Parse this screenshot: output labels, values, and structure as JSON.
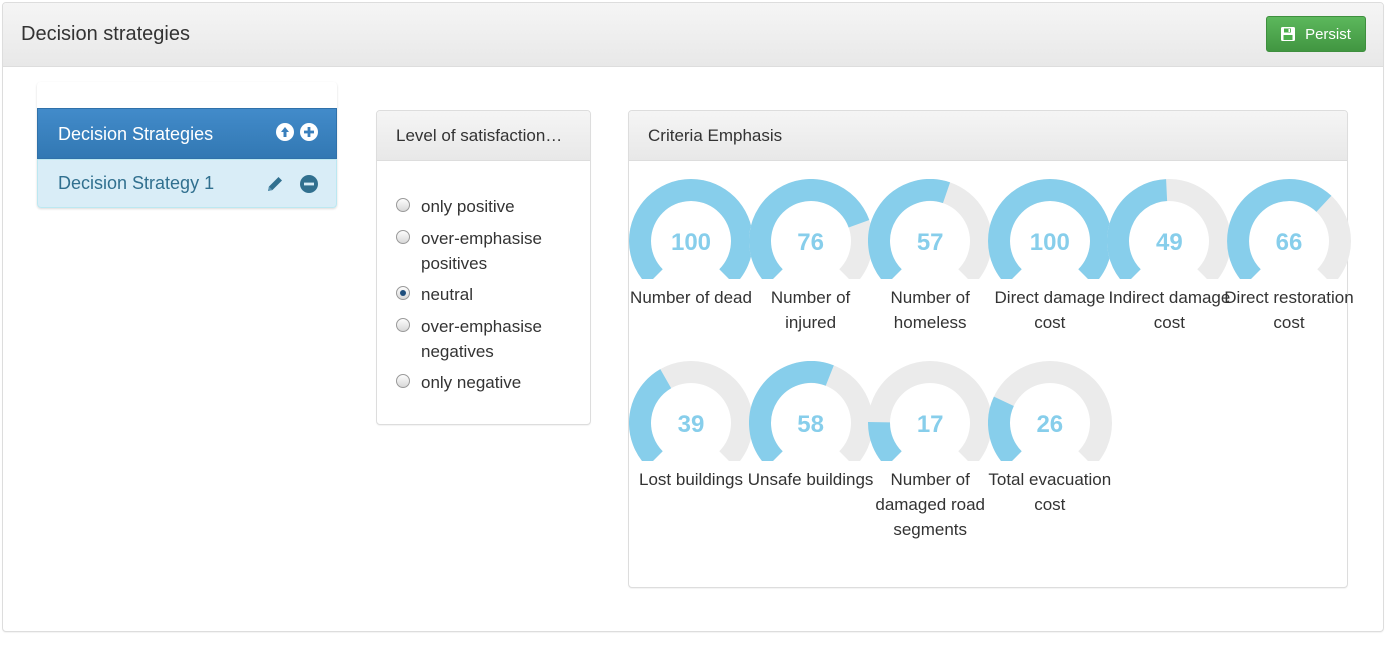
{
  "header": {
    "title": "Decision strategies",
    "persist_label": "Persist"
  },
  "strategies": {
    "header_label": "Decision Strategies",
    "items": [
      {
        "label": "Decision Strategy 1"
      }
    ]
  },
  "satisfaction": {
    "title": "Level of satisfaction…",
    "options": [
      {
        "label": "only positive",
        "checked": false
      },
      {
        "label": "over-emphasise positives",
        "checked": false
      },
      {
        "label": "neutral",
        "checked": true
      },
      {
        "label": "over-emphasise negatives",
        "checked": false
      },
      {
        "label": "only negative",
        "checked": false
      }
    ]
  },
  "criteria": {
    "title": "Criteria Emphasis",
    "gauge_color": "#87ceeb",
    "track_color": "#ebebeb",
    "items": [
      {
        "value": 100,
        "label": "Number of dead"
      },
      {
        "value": 76,
        "label": "Number of injured"
      },
      {
        "value": 57,
        "label": "Number of homeless"
      },
      {
        "value": 100,
        "label": "Direct damage cost"
      },
      {
        "value": 49,
        "label": "Indirect damage cost"
      },
      {
        "value": 66,
        "label": "Direct restoration cost"
      },
      {
        "value": 39,
        "label": "Lost buildings"
      },
      {
        "value": 58,
        "label": "Unsafe buildings"
      },
      {
        "value": 17,
        "label": "Number of damaged road segments"
      },
      {
        "value": 26,
        "label": "Total evacuation cost"
      }
    ]
  },
  "colors": {
    "primary": "#428bca",
    "success": "#5cb85c",
    "info_bg": "#d9edf7",
    "info_text": "#31708f"
  },
  "icons": {
    "persist": "floppy-disk-icon",
    "move_up": "circle-arrow-up-icon",
    "add": "plus-circle-icon",
    "edit": "pencil-icon",
    "remove": "minus-circle-icon"
  }
}
